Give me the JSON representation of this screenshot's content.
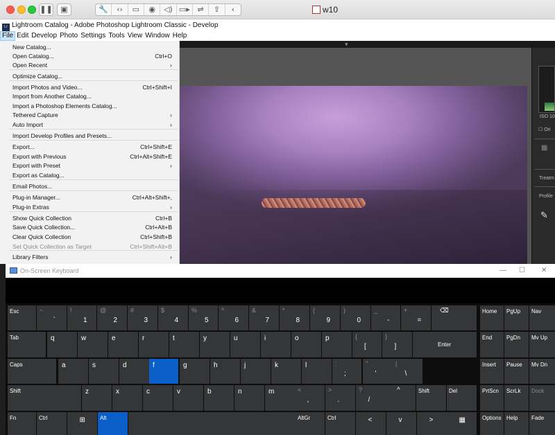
{
  "vm": {
    "title": "w10",
    "toolbar_icons": [
      "pause-icon",
      "snapshot-icon",
      "wrench-icon",
      "code-icon",
      "drive-icon",
      "camera-icon",
      "speaker-icon",
      "video-icon",
      "usb-icon",
      "share-icon",
      "chevron-left-icon"
    ]
  },
  "app": {
    "title": "Lightroom Catalog - Adobe Photoshop Lightroom Classic - Develop",
    "icon": "Lr",
    "menu": [
      "File",
      "Edit",
      "Develop",
      "Photo",
      "Settings",
      "Tools",
      "View",
      "Window",
      "Help"
    ]
  },
  "file_menu": [
    {
      "label": "New Catalog...",
      "shortcut": ""
    },
    {
      "label": "Open Catalog...",
      "shortcut": "Ctrl+O"
    },
    {
      "label": "Open Recent",
      "shortcut": "›"
    },
    {
      "label": "Optimize Catalog...",
      "shortcut": ""
    },
    {
      "label": "Import Photos and Video...",
      "shortcut": "Ctrl+Shift+I"
    },
    {
      "label": "Import from Another Catalog...",
      "shortcut": ""
    },
    {
      "label": "Import a Photoshop Elements Catalog...",
      "shortcut": ""
    },
    {
      "label": "Tethered Capture",
      "shortcut": "›"
    },
    {
      "label": "Auto Import",
      "shortcut": "›"
    },
    {
      "label": "Import Develop Profiles and Presets...",
      "shortcut": ""
    },
    {
      "label": "Export...",
      "shortcut": "Ctrl+Shift+E"
    },
    {
      "label": "Export with Previous",
      "shortcut": "Ctrl+Alt+Shift+E"
    },
    {
      "label": "Export with Preset",
      "shortcut": "›"
    },
    {
      "label": "Export as Catalog...",
      "shortcut": ""
    },
    {
      "label": "Email Photos...",
      "shortcut": ""
    },
    {
      "label": "Plug-in Manager...",
      "shortcut": "Ctrl+Alt+Shift+,"
    },
    {
      "label": "Plug-in Extras",
      "shortcut": "›"
    },
    {
      "label": "Show Quick Collection",
      "shortcut": "Ctrl+B"
    },
    {
      "label": "Save Quick Collection...",
      "shortcut": "Ctrl+Alt+B"
    },
    {
      "label": "Clear Quick Collection",
      "shortcut": "Ctrl+Shift+B"
    },
    {
      "label": "Set Quick Collection as Target",
      "shortcut": "Ctrl+Shift+Alt+B"
    },
    {
      "label": "Library Filters",
      "shortcut": "›"
    }
  ],
  "right_panel": {
    "iso": "ISO 10",
    "orig": "Ori",
    "treatment": "Treatm",
    "profile": "Profile"
  },
  "osk": {
    "title": "On-Screen Keyboard",
    "rows": [
      [
        [
          "Esc",
          ""
        ],
        [
          "`",
          "~"
        ],
        [
          "1",
          "!"
        ],
        [
          "2",
          "@"
        ],
        [
          "3",
          "#"
        ],
        [
          "4",
          "$"
        ],
        [
          "5",
          "%"
        ],
        [
          "6",
          "^"
        ],
        [
          "7",
          "&"
        ],
        [
          "8",
          "*"
        ],
        [
          "9",
          "("
        ],
        [
          "0",
          ")"
        ],
        [
          "-",
          "_"
        ],
        [
          "=",
          "+"
        ],
        [
          "⌫",
          ""
        ]
      ],
      [
        [
          "Tab",
          ""
        ],
        [
          "q",
          ""
        ],
        [
          "w",
          ""
        ],
        [
          "e",
          ""
        ],
        [
          "r",
          ""
        ],
        [
          "t",
          ""
        ],
        [
          "y",
          ""
        ],
        [
          "u",
          ""
        ],
        [
          "i",
          ""
        ],
        [
          "o",
          ""
        ],
        [
          "p",
          ""
        ],
        [
          "[",
          "{"
        ],
        [
          "]",
          "}"
        ],
        [
          "Enter",
          ""
        ]
      ],
      [
        [
          "Caps",
          ""
        ],
        [
          "a",
          ""
        ],
        [
          "s",
          ""
        ],
        [
          "d",
          ""
        ],
        [
          "f",
          ""
        ],
        [
          "g",
          ""
        ],
        [
          "h",
          ""
        ],
        [
          "j",
          ""
        ],
        [
          "k",
          ""
        ],
        [
          "l",
          ""
        ],
        [
          ";",
          ":"
        ],
        [
          "'",
          "\""
        ],
        [
          "\\",
          "|"
        ]
      ],
      [
        [
          "Shift",
          ""
        ],
        [
          "z",
          ""
        ],
        [
          "x",
          ""
        ],
        [
          "c",
          ""
        ],
        [
          "v",
          ""
        ],
        [
          "b",
          ""
        ],
        [
          "n",
          ""
        ],
        [
          "m",
          ""
        ],
        [
          ",",
          "<"
        ],
        [
          ".",
          ">"
        ],
        [
          "/",
          "?"
        ],
        [
          "",
          ""
        ],
        [
          "Shift",
          ""
        ],
        [
          "Del",
          ""
        ]
      ],
      [
        [
          "Fn",
          ""
        ],
        [
          "Ctrl",
          ""
        ],
        [
          "⊞",
          ""
        ],
        [
          "Alt",
          ""
        ],
        [
          "",
          ""
        ],
        [
          "AltGr",
          ""
        ],
        [
          "Ctrl",
          ""
        ],
        [
          "<",
          ""
        ],
        [
          "v",
          ""
        ],
        [
          ">",
          ""
        ],
        [
          "▦",
          ""
        ]
      ]
    ],
    "nav": [
      [
        "Home",
        "PgUp",
        "Nav"
      ],
      [
        "End",
        "PgDn",
        "Mv Up"
      ],
      [
        "Insert",
        "Pause",
        "Mv Dn"
      ],
      [
        "PrtScn",
        "ScrLk",
        "Dock"
      ],
      [
        "Options",
        "Help",
        "Fade"
      ]
    ]
  },
  "colors": {
    "highlight": "#0a5ec7",
    "key": "#353637",
    "menu_active": "#cce4f7"
  }
}
